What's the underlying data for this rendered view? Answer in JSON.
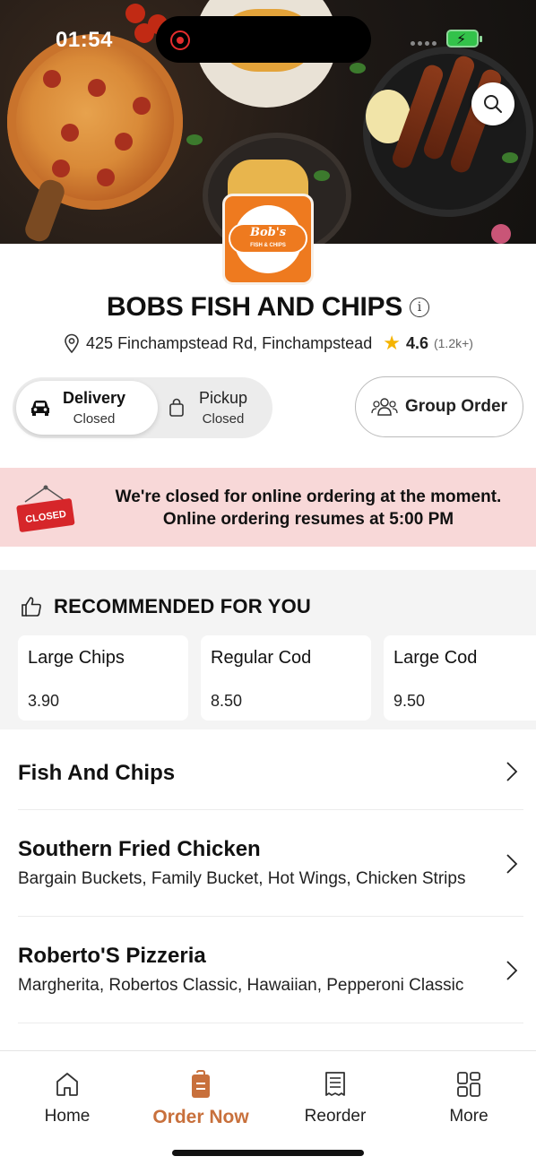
{
  "status_bar": {
    "time": "01:54"
  },
  "restaurant": {
    "name": "BOBS FISH AND CHIPS",
    "address": "425 Finchampstead Rd, Finchampstead",
    "rating": "4.6",
    "rating_count": "(1.2k+)",
    "logo_text": "Bob's",
    "logo_sub": "FISH & CHIPS"
  },
  "modes": {
    "delivery": {
      "label": "Delivery",
      "status": "Closed"
    },
    "pickup": {
      "label": "Pickup",
      "status": "Closed"
    }
  },
  "group_order": {
    "label": "Group Order"
  },
  "closed_banner": {
    "sign": "CLOSED",
    "line1": "We're closed for online ordering at the moment.",
    "line2": "Online ordering resumes at 5:00 PM"
  },
  "recommended": {
    "title": "RECOMMENDED FOR YOU",
    "items": [
      {
        "name": "Large Chips",
        "price": "3.90"
      },
      {
        "name": "Regular Cod",
        "price": "8.50"
      },
      {
        "name": "Large Cod",
        "price": "9.50"
      }
    ]
  },
  "categories": [
    {
      "name": "Fish And Chips",
      "desc": ""
    },
    {
      "name": "Southern Fried Chicken",
      "desc": "Bargain Buckets, Family Bucket, Hot Wings, Chicken Strips"
    },
    {
      "name": "Roberto'S Pizzeria",
      "desc": "Margherita, Robertos Classic, Hawaiian, Pepperoni Classic"
    }
  ],
  "tabs": [
    {
      "label": "Home",
      "icon": "home-icon"
    },
    {
      "label": "Order Now",
      "icon": "order-bag-icon",
      "active": true
    },
    {
      "label": "Reorder",
      "icon": "receipt-icon"
    },
    {
      "label": "More",
      "icon": "grid-icon"
    }
  ],
  "colors": {
    "accent": "#c8703c",
    "banner": "#f8d8d8",
    "logo": "#ee7a1f",
    "star": "#f5b400"
  }
}
